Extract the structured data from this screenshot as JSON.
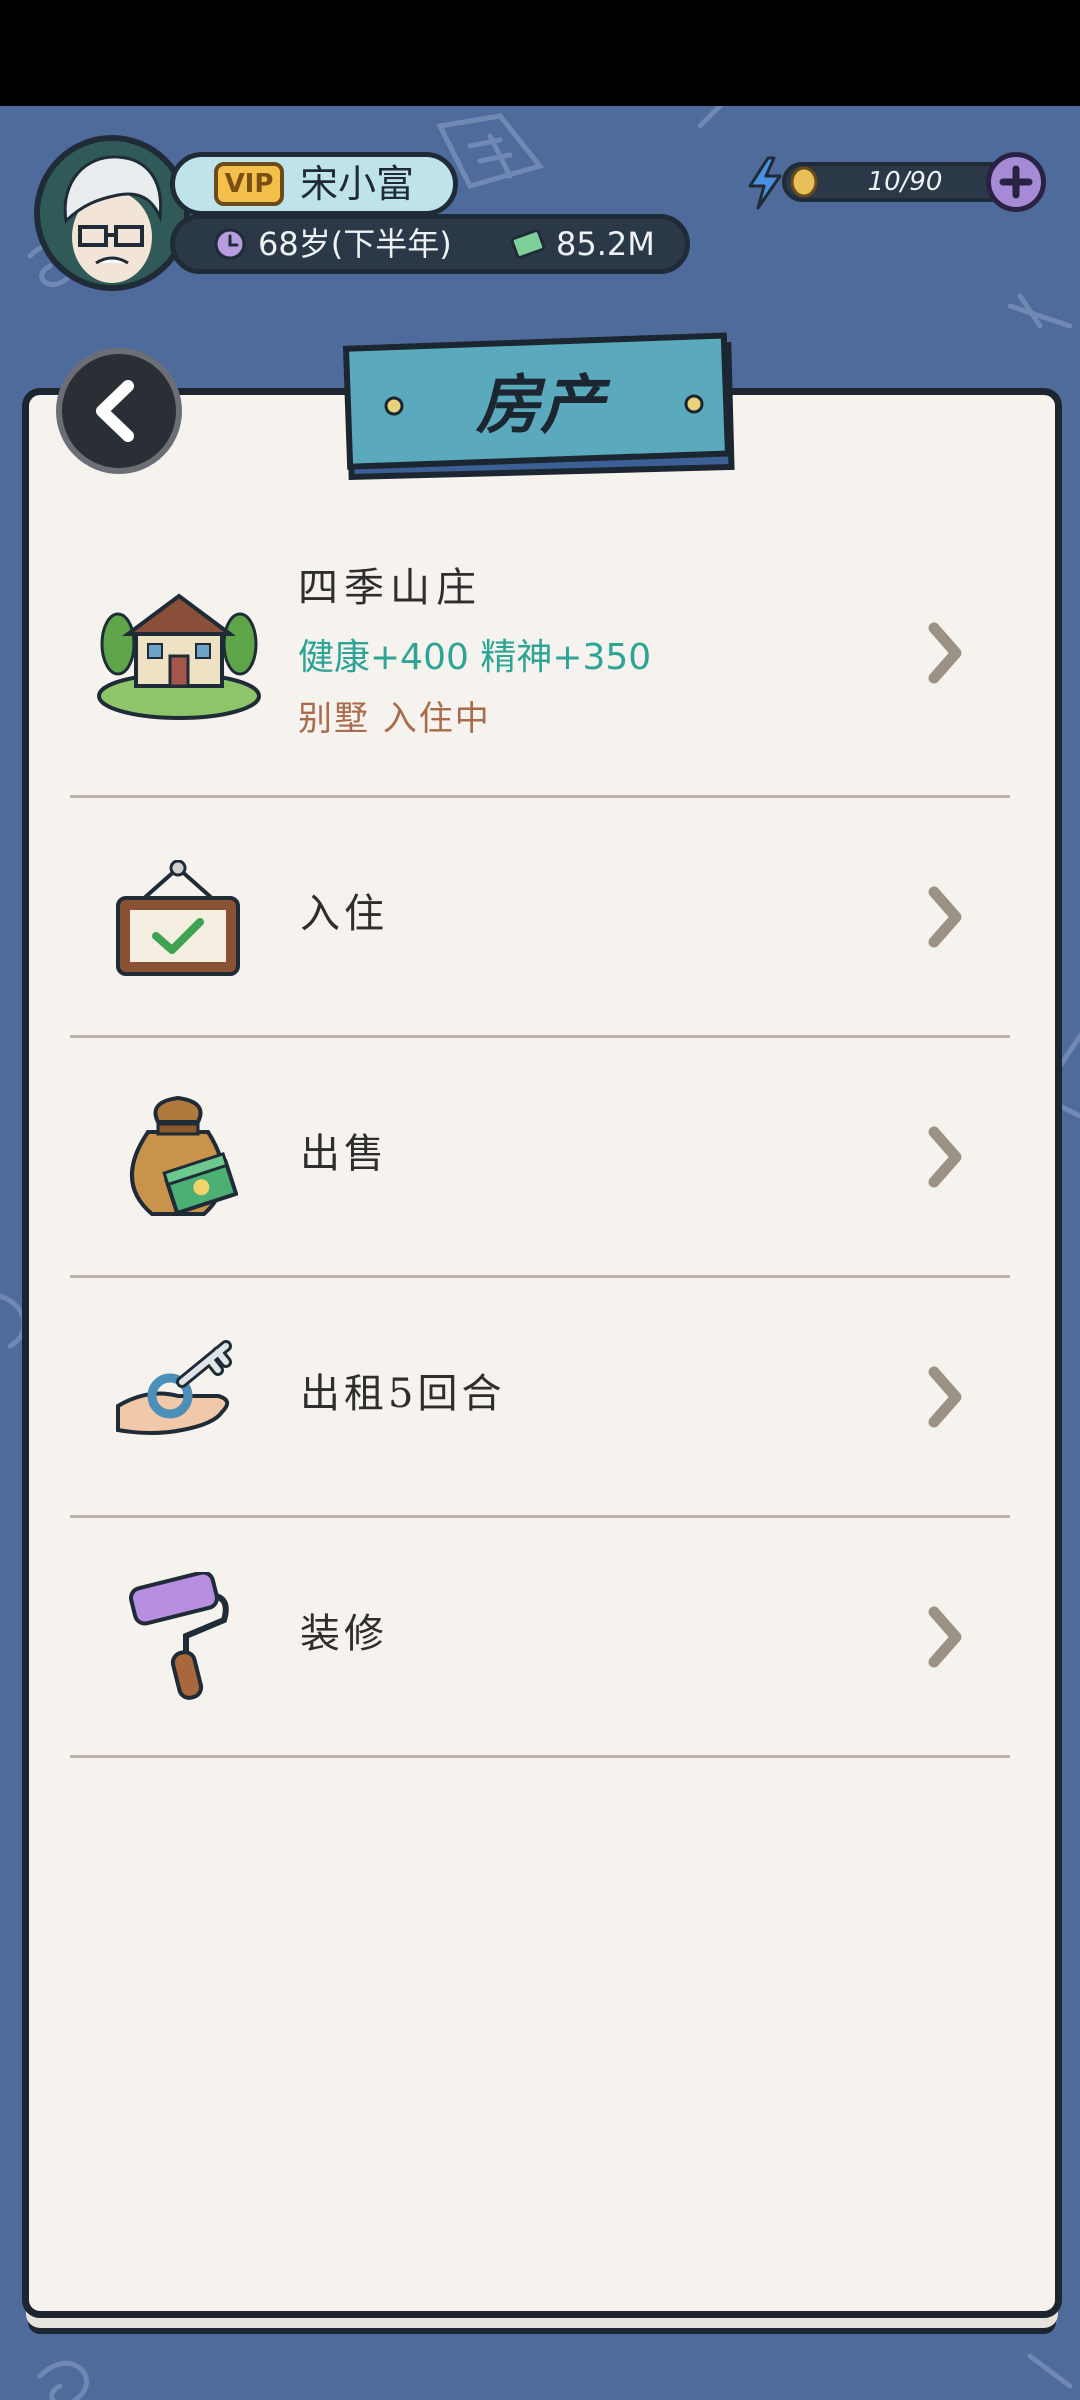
{
  "player": {
    "vip_label": "VIP",
    "name": "宋小富",
    "age": "68岁(下半年)",
    "money": "85.2M"
  },
  "energy": {
    "value": "10/90"
  },
  "header": {
    "title": "房产"
  },
  "property": {
    "name": "四季山庄",
    "bonus": "健康+400 精神+350",
    "status": "别墅 入住中"
  },
  "actions": [
    {
      "label": "入住",
      "icon": "signboard-check-icon"
    },
    {
      "label": "出售",
      "icon": "money-bag-icon"
    },
    {
      "label": "出租5回合",
      "icon": "hand-key-icon"
    },
    {
      "label": "装修",
      "icon": "paint-roller-icon"
    }
  ],
  "colors": {
    "background": "#4f6b9c",
    "panel": "#f6f2ee",
    "bonus_text": "#2ea495",
    "status_text": "#a86b4b",
    "title_board": "#5aa9bd"
  }
}
